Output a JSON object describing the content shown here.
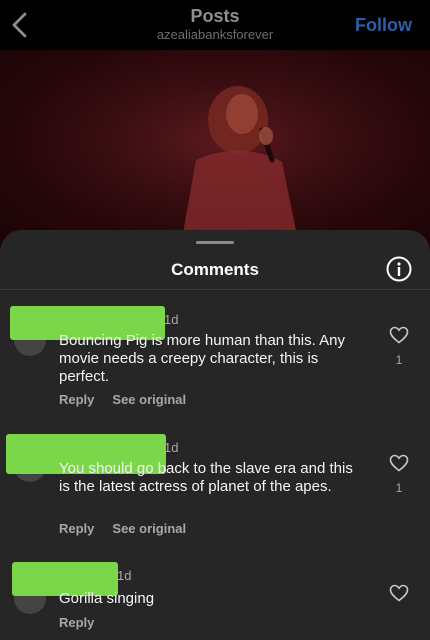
{
  "header": {
    "title": "Posts",
    "username": "azealiabanksforever",
    "follow_label": "Follow"
  },
  "comments_sheet": {
    "title": "Comments"
  },
  "comments": [
    {
      "age": "1d",
      "text": "Bouncing Pig is more human than this. Any movie needs a creepy character, this is perfect.",
      "reply_label": "Reply",
      "see_original_label": "See original",
      "likes": "1"
    },
    {
      "age": "1d",
      "text": "You should go back to the slave era and this is the latest actress of planet of the apes.",
      "reply_label": "Reply",
      "see_original_label": "See original",
      "likes": "1"
    },
    {
      "age": "1d",
      "text": "Gorilla singing",
      "reply_label": "Reply"
    }
  ],
  "colors": {
    "redaction": "#7bd64a",
    "sheet_bg": "#262626",
    "follow": "#2b5fa8",
    "photo_tint": "#3a0e12"
  }
}
